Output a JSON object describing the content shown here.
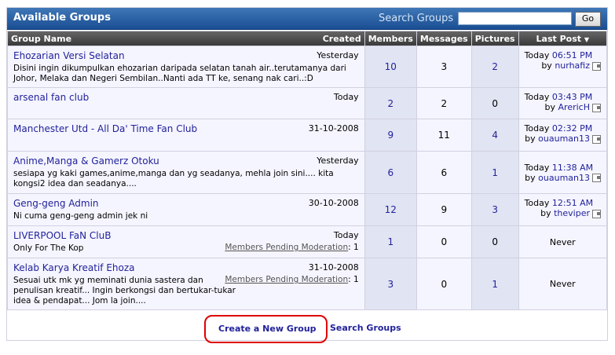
{
  "header": {
    "title": "Available Groups",
    "search_label": "Search Groups",
    "search_value": "",
    "go_label": "Go"
  },
  "columns": {
    "group_name": "Group Name",
    "created": "Created",
    "members": "Members",
    "messages": "Messages",
    "pictures": "Pictures",
    "last_post": "Last Post"
  },
  "rows": [
    {
      "name": "Ehozarian Versi Selatan",
      "created": "Yesterday",
      "desc": "Disini ingin dikumpulkan ehozarian daripada selatan tanah air..terutamanya dari Johor, Melaka dan Negeri Sembilan..Nanti ada TT ke, senang nak cari..:D",
      "members": "10",
      "messages": "3",
      "pictures": "2",
      "last_date": "Today",
      "last_time": "06:51 PM",
      "by": "by",
      "last_user": "nurhafiz"
    },
    {
      "name": "arsenal fan club",
      "created": "Today",
      "desc": "",
      "members": "2",
      "messages": "2",
      "pictures": "0",
      "last_date": "Today",
      "last_time": "03:43 PM",
      "by": "by",
      "last_user": "ArericH"
    },
    {
      "name": "Manchester Utd - All Da' Time Fan Club",
      "created": "31-10-2008",
      "desc": "",
      "members": "9",
      "messages": "11",
      "pictures": "4",
      "last_date": "Today",
      "last_time": "02:32 PM",
      "by": "by",
      "last_user": "ouauman13"
    },
    {
      "name": "Anime,Manga & Gamerz Otoku",
      "created": "Yesterday",
      "desc": "sesiapa yg kaki games,anime,manga dan yg seadanya, mehla join sini.... kita kongsi2 idea dan seadanya....",
      "members": "6",
      "messages": "6",
      "pictures": "1",
      "last_date": "Today",
      "last_time": "11:38 AM",
      "by": "by",
      "last_user": "ouauman13"
    },
    {
      "name": "Geng-geng Admin",
      "created": "30-10-2008",
      "desc": "Ni cuma geng-geng admin jek ni",
      "members": "12",
      "messages": "9",
      "pictures": "3",
      "last_date": "Today",
      "last_time": "12:51 AM",
      "by": "by",
      "last_user": "theviper"
    },
    {
      "name": "LIVERPOOL FaN CluB",
      "created": "Today",
      "desc": "Only For The Kop",
      "pending_label": "Members Pending Moderation",
      "pending_count": ": 1",
      "members": "1",
      "messages": "0",
      "pictures": "0",
      "never": "Never"
    },
    {
      "name": "Kelab Karya Kreatif Ehoza",
      "created": "31-10-2008",
      "desc": "Sesuai utk mk yg meminati dunia sastera dan penulisan kreatif... Ingin berkongsi dan bertukar-tukar idea & pendapat... Jom la join....",
      "pending_label": "Members Pending Moderation",
      "pending_count": ": 1",
      "members": "3",
      "messages": "0",
      "pictures": "1",
      "never": "Never"
    }
  ],
  "footer": {
    "create_label": "Create a New Group",
    "search_label": "Search Groups"
  },
  "colors": {
    "header_blue": "#2c62a5",
    "link": "#22229c",
    "highlight_ring": "#e00000"
  }
}
